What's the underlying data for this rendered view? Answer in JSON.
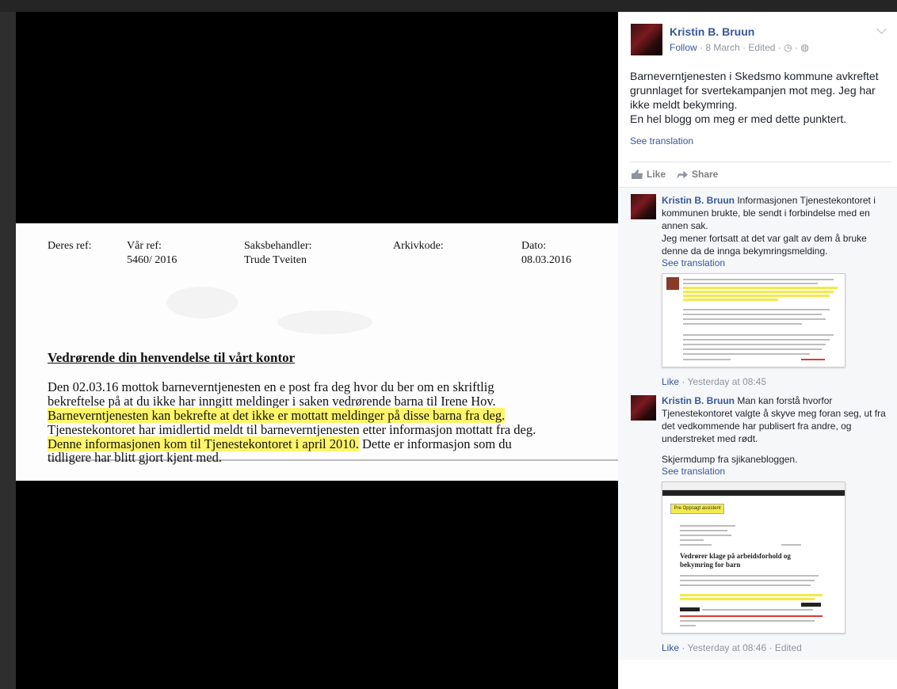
{
  "document": {
    "labels": {
      "deres_ref": "Deres ref:",
      "var_ref": "Vår ref:",
      "saksbehandler": "Saksbehandler:",
      "arkivkode": "Arkivkode:",
      "dato": "Dato:"
    },
    "values": {
      "var_ref": "5460/ 2016",
      "saksbehandler": "Trude Tveiten",
      "dato": "08.03.2016"
    },
    "heading": "Vedrørende din henvendelse til vårt kontor",
    "lines": {
      "l1": "Den 02.03.16 mottok barneverntjenesten en e post fra deg hvor du ber om en skriftlig",
      "l2": "bekreftelse på at du ikke har inngitt meldinger i saken vedrørende barna til Irene Hov.",
      "l3_highlight": "Barneverntjenesten kan bekrefte at det ikke er mottatt meldinger på disse barna fra deg.",
      "l4": "Tjenestekontoret har imidlertid meldt til barneverntjenesten etter informasjon mottatt fra deg.",
      "l5_highlight": "Denne informasjonen kom til Tjenestekontoret i april 2010.",
      "l5_rest": " Dette er informasjon som du",
      "l6": "tidligere har blitt gjort kjent med."
    }
  },
  "post": {
    "author": "Kristin B. Bruun",
    "follow": "Follow",
    "date": "8 March",
    "edited": "Edited",
    "text_lines": [
      "Barneverntjenesten i Skedsmo kommune avkreftet grunnlaget for svertekampanjen mot meg. Jeg har ikke meldt bekymring.",
      "En hel blogg om meg er med dette punktert."
    ],
    "see_translation": "See translation",
    "actions": {
      "like": "Like",
      "share": "Share"
    }
  },
  "comments": [
    {
      "author": "Kristin B. Bruun",
      "text": "Informasjonen Tjenestekontoret i kommunen brukte, ble sendt i forbindelse med en annen sak.",
      "text2": "Jeg mener fortsatt at det var galt av dem å bruke denne da de innga bekymringsmelding.",
      "see_translation": "See translation",
      "like": "Like",
      "time": "Yesterday at 08:45"
    },
    {
      "author": "Kristin B. Bruun",
      "text": "Man kan forstå hvorfor Tjenestekontoret valgte å skyve meg foran seg, ut fra det vedkommende har publisert fra andre, og understreket med rødt.",
      "text2": "Skjermdump fra sjikanebloggen.",
      "see_translation": "See translation",
      "like": "Like",
      "time": "Yesterday at 08:46",
      "edited": "Edited"
    }
  ],
  "thumbnail_2": {
    "button": "Pre Oppsagt assistent",
    "heading": "Vedrører klage på arbeidsforhold og bekymring for barn"
  },
  "colors": {
    "link": "#365899",
    "highlight": "#fff56a",
    "panel_bg": "#ffffff",
    "stage_bg": "#000000"
  },
  "icons": [
    "chevron-down-icon",
    "clock-icon",
    "globe-icon",
    "like-icon",
    "share-icon"
  ]
}
